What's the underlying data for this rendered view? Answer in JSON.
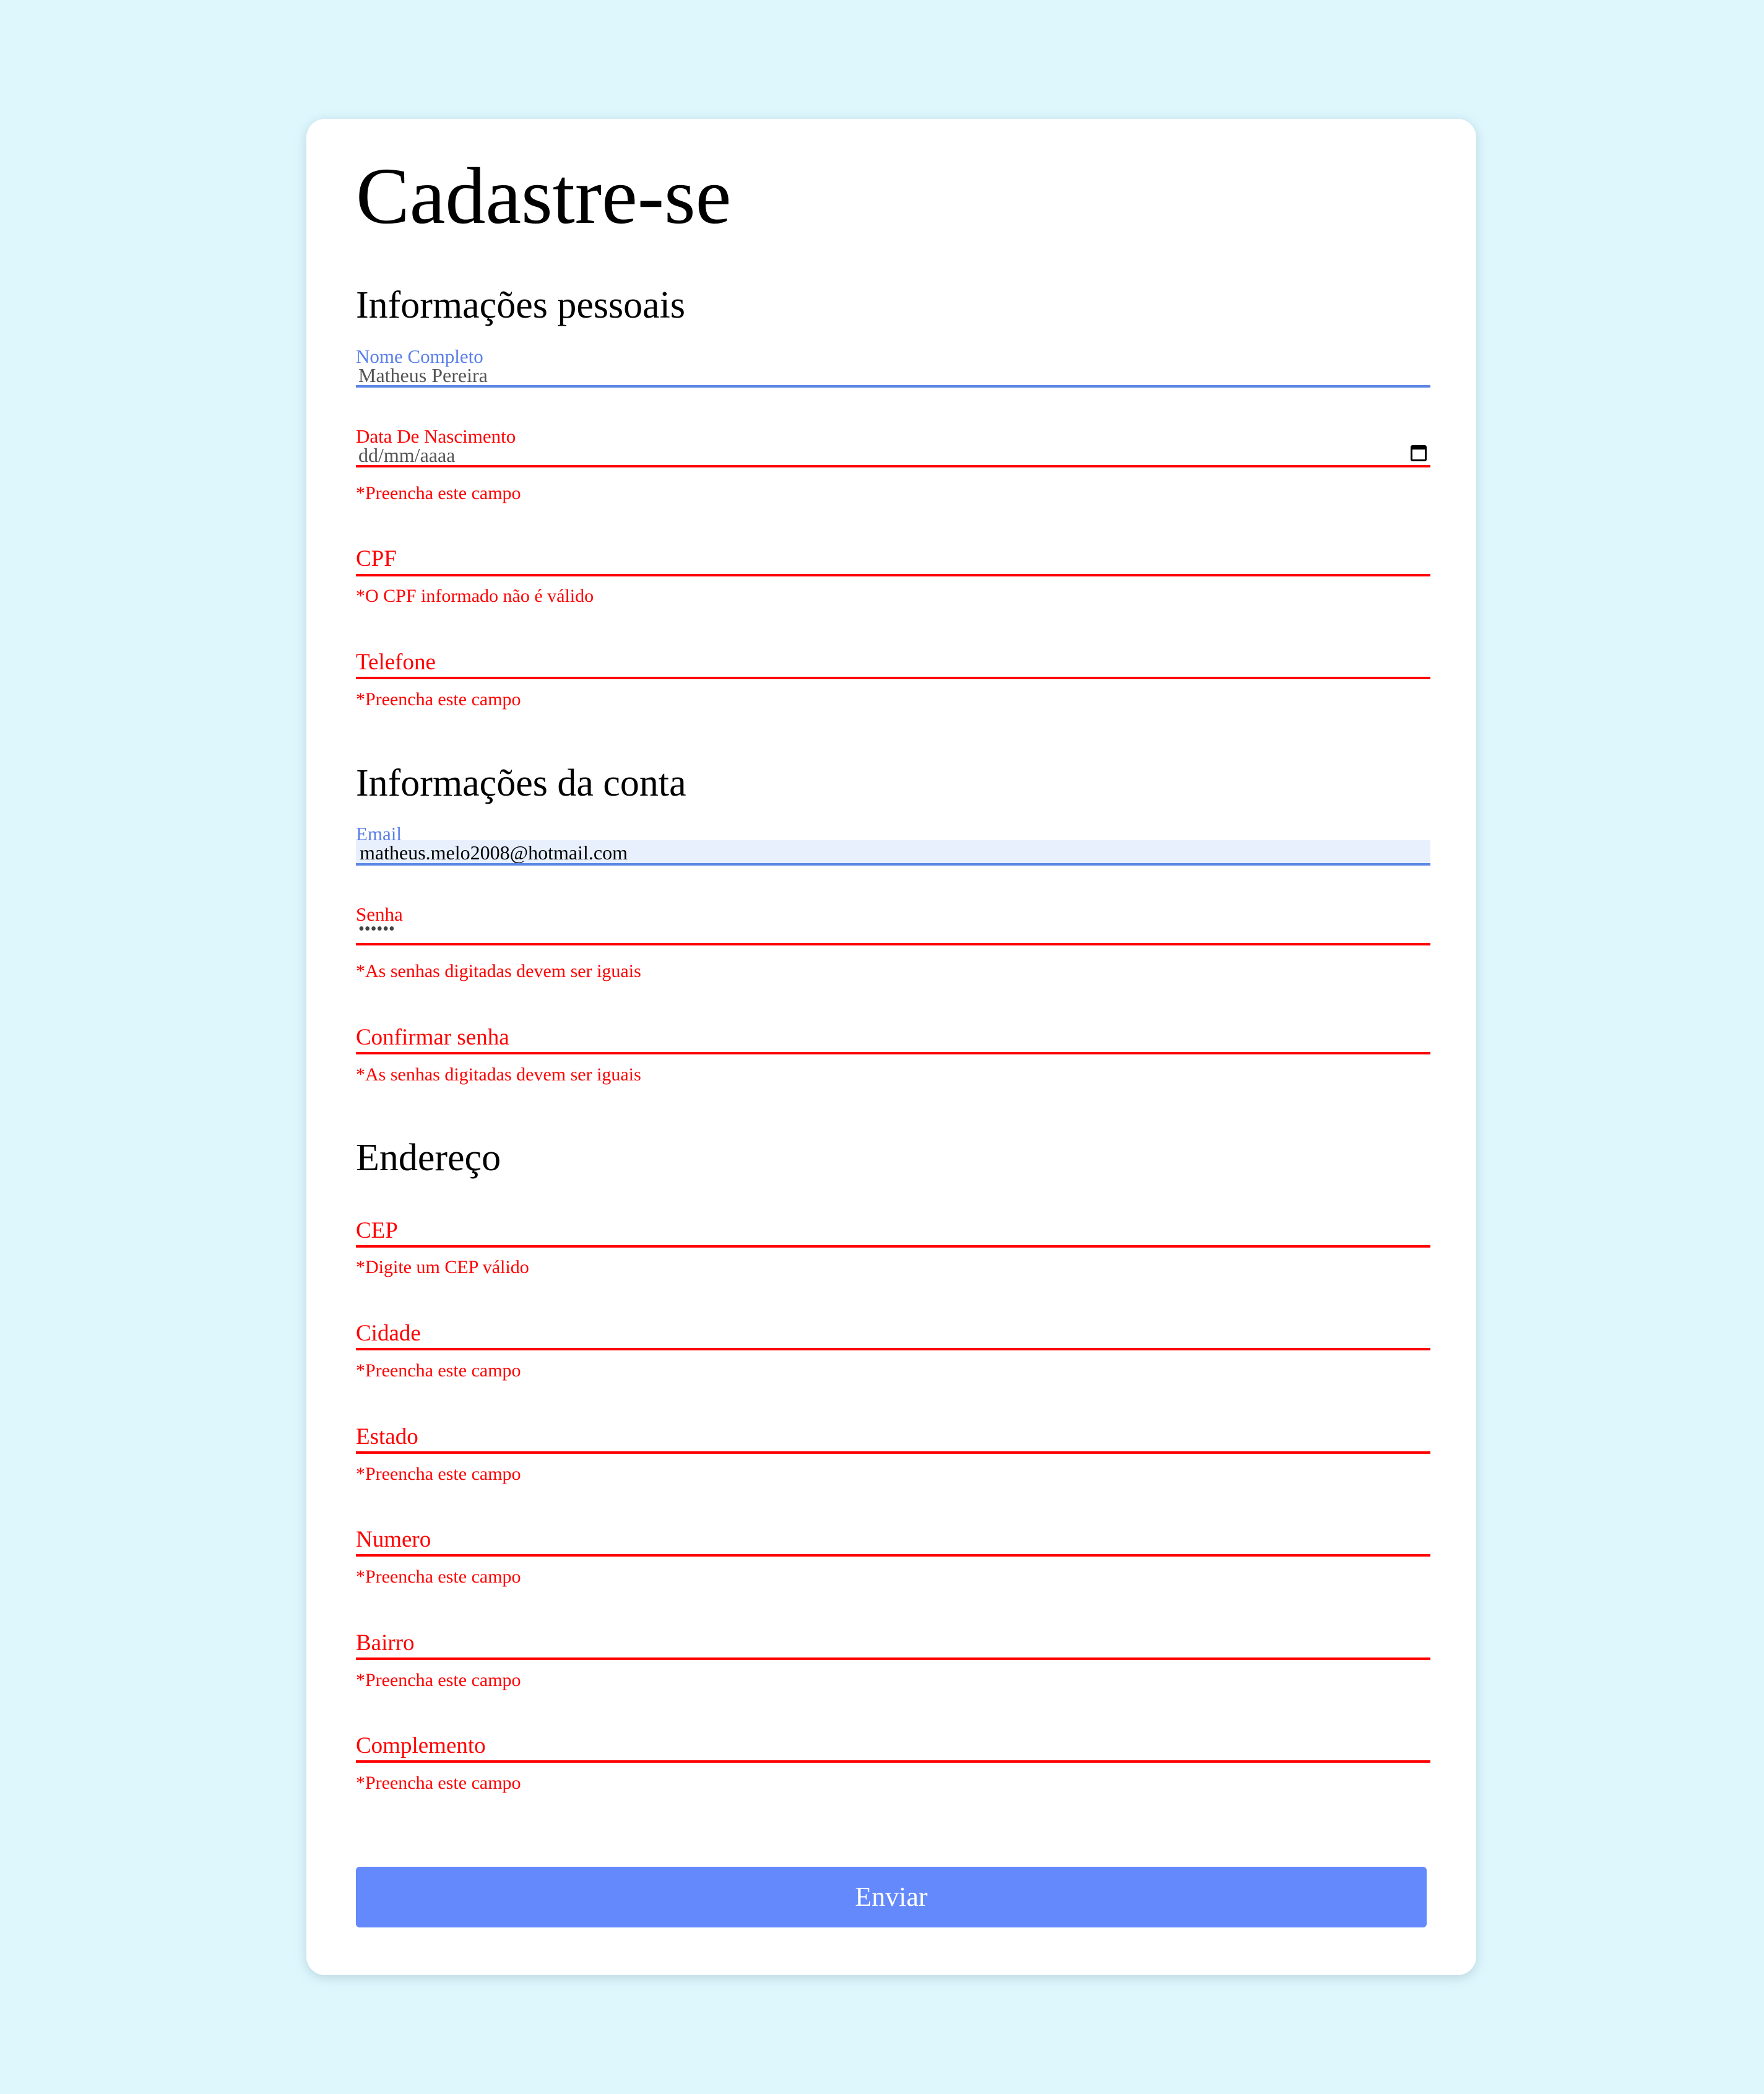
{
  "form": {
    "title": "Cadastre-se",
    "sections": {
      "personal": "Informações pessoais",
      "account": "Informações da conta",
      "address": "Endereço"
    },
    "fields": {
      "nome": {
        "label": "Nome Completo",
        "value": "Matheus Pereira"
      },
      "nascimento": {
        "label": "Data De Nascimento",
        "placeholder": "dd/mm/aaaa",
        "error": "*Preencha este campo"
      },
      "cpf": {
        "label": "CPF",
        "error": "*O CPF informado não é válido"
      },
      "telefone": {
        "label": "Telefone",
        "error": "*Preencha este campo"
      },
      "email": {
        "label": "Email",
        "value": "matheus.melo2008@hotmail.com"
      },
      "senha": {
        "label": "Senha",
        "value": "••••••",
        "error": "*As senhas digitadas devem ser iguais"
      },
      "confirmar": {
        "label": "Confirmar senha",
        "error": "*As senhas digitadas devem ser iguais"
      },
      "cep": {
        "label": "CEP",
        "error": "*Digite um CEP válido"
      },
      "cidade": {
        "label": "Cidade",
        "error": "*Preencha este campo"
      },
      "estado": {
        "label": "Estado",
        "error": "*Preencha este campo"
      },
      "numero": {
        "label": "Numero",
        "error": "*Preencha este campo"
      },
      "bairro": {
        "label": "Bairro",
        "error": "*Preencha este campo"
      },
      "complemento": {
        "label": "Complemento",
        "error": "*Preencha este campo"
      }
    },
    "submit_label": "Enviar"
  },
  "colors": {
    "background": "#def7fd",
    "focus_blue": "#5b86e5",
    "error_red": "#ff0000",
    "button": "#6389fd"
  }
}
